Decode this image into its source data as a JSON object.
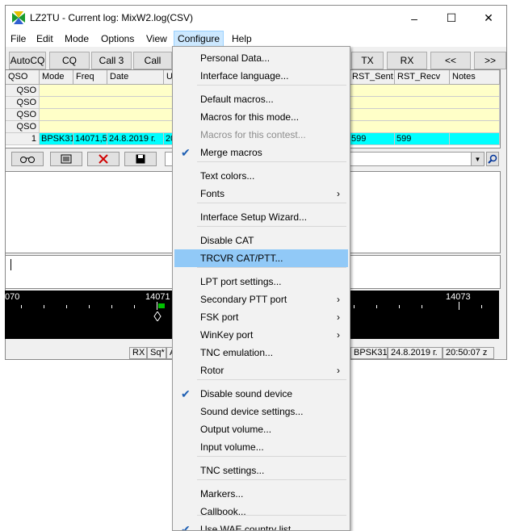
{
  "window": {
    "title": "LZ2TU - Current log: MixW2.log(CSV)",
    "minimize": "–",
    "maximize": "☐",
    "close": "✕"
  },
  "menubar": [
    "File",
    "Edit",
    "Mode",
    "Options",
    "View",
    "Configure",
    "Help"
  ],
  "toolbar": [
    "AutoCQ",
    "CQ",
    "Call 3",
    "Call",
    "TX",
    "RX",
    "<<",
    ">>"
  ],
  "grid": {
    "headers": [
      "QSO",
      "Mode",
      "Freq",
      "Date",
      "U",
      "RST_Sent",
      "RST_Recv",
      "Notes"
    ],
    "empty_rows": [
      "QSO",
      "QSO",
      "QSO",
      "QSO"
    ],
    "row": {
      "num": "1",
      "mode": "BPSK31",
      "freq": "14071,5",
      "date": "24.8.2019 г.",
      "u": "20",
      "rst_sent": "599",
      "rst_recv": "599"
    }
  },
  "waterfall": {
    "labels": [
      "070",
      "14071",
      "14073"
    ]
  },
  "statusbar": {
    "rx": "RX",
    "sq": "Sq*",
    "a": "A",
    "mode": "BPSK31",
    "date": "24.8.2019 г.",
    "time": "20:50:07 z"
  },
  "configure_menu": [
    {
      "label": "Personal Data...",
      "checked": false,
      "submenu": false,
      "disabled": false
    },
    {
      "label": "Interface language...",
      "checked": false,
      "submenu": false,
      "disabled": false
    },
    {
      "label": "Default macros...",
      "checked": false,
      "submenu": false,
      "disabled": false
    },
    {
      "label": "Macros for this mode...",
      "checked": false,
      "submenu": false,
      "disabled": false
    },
    {
      "label": "Macros for this contest...",
      "checked": false,
      "submenu": false,
      "disabled": true
    },
    {
      "label": "Merge macros",
      "checked": true,
      "submenu": false,
      "disabled": false
    },
    {
      "label": "Text colors...",
      "checked": false,
      "submenu": false,
      "disabled": false
    },
    {
      "label": "Fonts",
      "checked": false,
      "submenu": true,
      "disabled": false
    },
    {
      "label": "Interface Setup Wizard...",
      "checked": false,
      "submenu": false,
      "disabled": false
    },
    {
      "label": "Disable CAT",
      "checked": false,
      "submenu": false,
      "disabled": false
    },
    {
      "label": "TRCVR CAT/PTT...",
      "checked": false,
      "submenu": false,
      "disabled": false,
      "highlighted": true
    },
    {
      "label": "LPT port settings...",
      "checked": false,
      "submenu": false,
      "disabled": false
    },
    {
      "label": "Secondary PTT port",
      "checked": false,
      "submenu": true,
      "disabled": false
    },
    {
      "label": "FSK port",
      "checked": false,
      "submenu": true,
      "disabled": false
    },
    {
      "label": "WinKey port",
      "checked": false,
      "submenu": true,
      "disabled": false
    },
    {
      "label": "TNC emulation...",
      "checked": false,
      "submenu": false,
      "disabled": false
    },
    {
      "label": "Rotor",
      "checked": false,
      "submenu": true,
      "disabled": false
    },
    {
      "label": "Disable sound device",
      "checked": true,
      "submenu": false,
      "disabled": false
    },
    {
      "label": "Sound device settings...",
      "checked": false,
      "submenu": false,
      "disabled": false
    },
    {
      "label": "Output volume...",
      "checked": false,
      "submenu": false,
      "disabled": false
    },
    {
      "label": "Input volume...",
      "checked": false,
      "submenu": false,
      "disabled": false
    },
    {
      "label": "TNC settings...",
      "checked": false,
      "submenu": false,
      "disabled": false
    },
    {
      "label": "Markers...",
      "checked": false,
      "submenu": false,
      "disabled": false
    },
    {
      "label": "Callbook...",
      "checked": false,
      "submenu": false,
      "disabled": false
    },
    {
      "label": "Use WAE country list",
      "checked": true,
      "submenu": false,
      "disabled": false
    }
  ],
  "colors": {
    "highlight": "#91c9f7",
    "active_menu": "#cce8ff",
    "grid_yellow": "#ffffc8",
    "grid_cyan": "#00ffff",
    "waterfall_bg": "#000000"
  }
}
